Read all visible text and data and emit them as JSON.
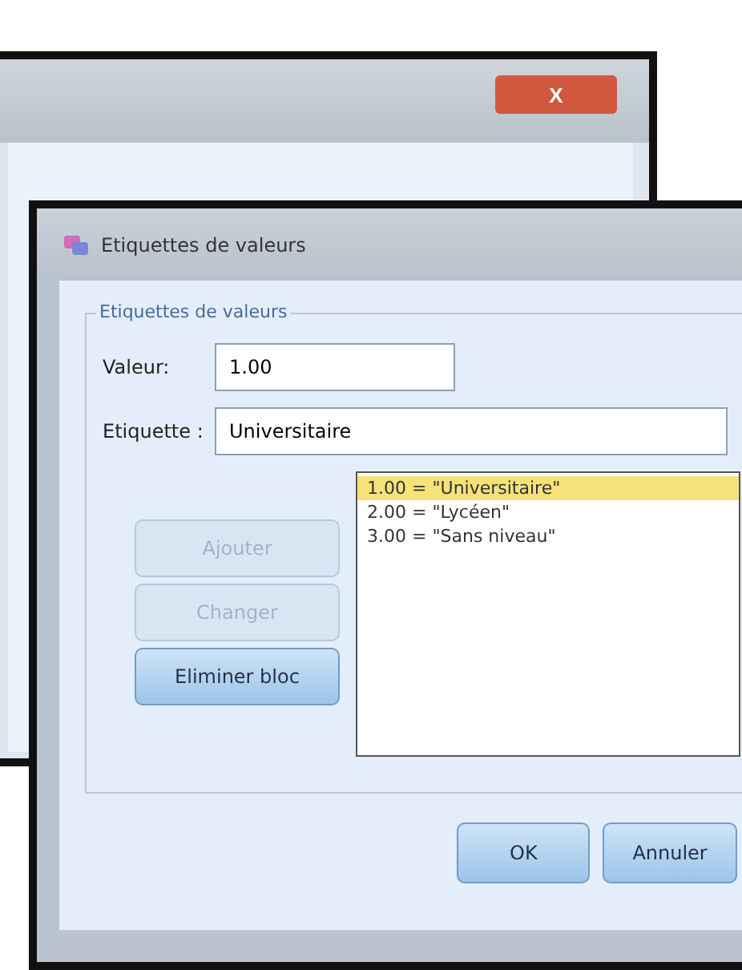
{
  "back_window": {
    "close_button": "X"
  },
  "dialog": {
    "title": "Etiquettes de valeurs",
    "group": {
      "legend": "Etiquettes de valeurs",
      "fields": [
        {
          "label": "Valeur:",
          "value": "1.00",
          "kind": "short"
        },
        {
          "label": "Etiquette :",
          "value": "Universitaire",
          "kind": "wide"
        }
      ],
      "buttons": [
        {
          "label": "Ajouter",
          "disabled": true
        },
        {
          "label": "Changer",
          "disabled": true
        },
        {
          "label": "Eliminer bloc",
          "disabled": false
        }
      ],
      "list": [
        {
          "text": "1.00 = \"Universitaire\"",
          "selected": true
        },
        {
          "text": "2.00 = \"Lycéen\"",
          "selected": false
        },
        {
          "text": "3.00 = \"Sans niveau\"",
          "selected": false
        }
      ]
    },
    "footer_buttons": [
      "OK",
      "Annuler"
    ]
  }
}
